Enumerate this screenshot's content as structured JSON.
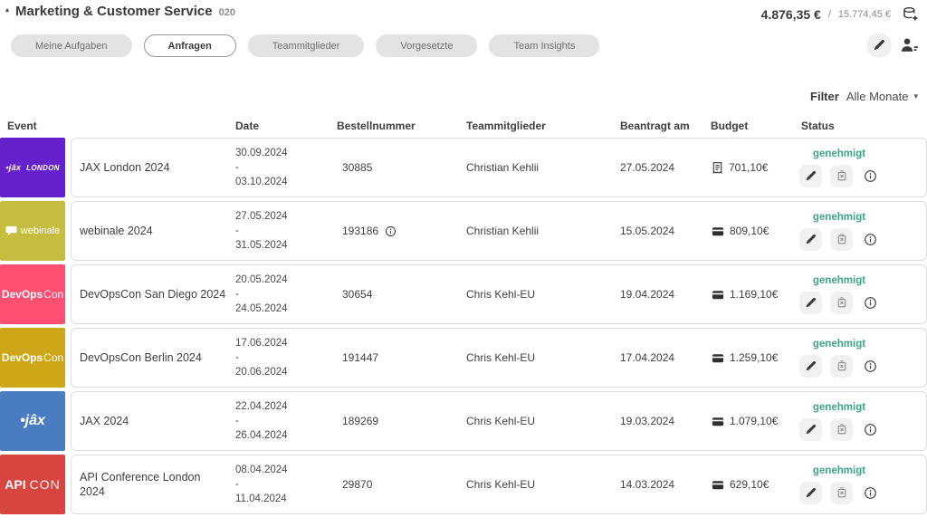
{
  "header": {
    "collapse_icon": "▴",
    "title": "Marketing & Customer Service",
    "code": "020",
    "budget_used": "4.876,35 €",
    "separator": "/",
    "budget_total": "15.774,45 €"
  },
  "tabs": [
    {
      "label": "Meine Aufgaben"
    },
    {
      "label": "Anfragen"
    },
    {
      "label": "Teammitglieder"
    },
    {
      "label": "Vorgesetzte"
    },
    {
      "label": "Team Insights"
    }
  ],
  "active_tab": "Anfragen",
  "filter": {
    "label": "Filter",
    "value": "Alle Monate",
    "caret": "▾"
  },
  "colors": {
    "status_approved": "#3fa38a",
    "logo_jax_london": "#6621cd",
    "logo_webinale": "#c5bd3f",
    "logo_devopscon_sandiego": "#fc4f72",
    "logo_devopscon_berlin": "#cda717",
    "logo_jax": "#4a7cc2",
    "logo_apicon": "#d84540"
  },
  "icons": {
    "top_right": "coins-plus-icon",
    "header_actions": [
      "pencil-icon",
      "person-add-icon"
    ],
    "row_actions": [
      "pencil-icon",
      "trash-icon",
      "info-icon"
    ],
    "budget_row_1": "receipt-icon",
    "budget_other_rows": "wallet-icon"
  },
  "table": {
    "columns": [
      "Event",
      "Date",
      "Bestellnummer",
      "Teammitglieder",
      "Beantragt am",
      "Budget",
      "Status"
    ],
    "rows": [
      {
        "logo": {
          "css": "background:#6621cd",
          "text1": "•jâx",
          "text2": "london"
        },
        "event": "JAX London 2024",
        "date_from": "30.09.2024",
        "date_sep": "-",
        "date_to": "03.10.2024",
        "bestellnummer": "30885",
        "teammitglied": "Christian Kehlii",
        "beantragt_am": "27.05.2024",
        "budget": "701,10€",
        "status": "genehmigt"
      },
      {
        "logo": {
          "css": "background:#c5bd3f",
          "text1": "",
          "text2": "webinale"
        },
        "event": "webinale 2024",
        "date_from": "27.05.2024",
        "date_sep": "-",
        "date_to": "31.05.2024",
        "bestellnummer": "193186",
        "teammitglied": "Christian Kehlii",
        "beantragt_am": "15.05.2024",
        "budget": "809,10€",
        "status": "genehmigt"
      },
      {
        "logo": {
          "css": "background:#fc4f72",
          "text1": "DevOps",
          "text2": "Con"
        },
        "event": "DevOpsCon San Diego 2024",
        "date_from": "20.05.2024",
        "date_sep": "-",
        "date_to": "24.05.2024",
        "bestellnummer": "30654",
        "teammitglied": "Chris Kehl-EU",
        "beantragt_am": "19.04.2024",
        "budget": "1.169,10€",
        "status": "genehmigt"
      },
      {
        "logo": {
          "css": "background:#cda717",
          "text1": "DevOps",
          "text2": "Con"
        },
        "event": "DevOpsCon Berlin 2024",
        "date_from": "17.06.2024",
        "date_sep": "-",
        "date_to": "20.06.2024",
        "bestellnummer": "191447",
        "teammitglied": "Chris Kehl-EU",
        "beantragt_am": "17.04.2024",
        "budget": "1.259,10€",
        "status": "genehmigt"
      },
      {
        "logo": {
          "css": "background:#4a7cc2",
          "text1": "•jâx",
          "text2": ""
        },
        "event": "JAX 2024",
        "date_from": "22.04.2024",
        "date_sep": "-",
        "date_to": "26.04.2024",
        "bestellnummer": "189269",
        "teammitglied": "Chris Kehl-EU",
        "beantragt_am": "19.03.2024",
        "budget": "1.079,10€",
        "status": "genehmigt"
      },
      {
        "logo": {
          "css": "background:#d84540",
          "text1": "API",
          "text2": "CON"
        },
        "event": "API Conference London 2024",
        "date_from": "08.04.2024",
        "date_sep": "-",
        "date_to": "11.04.2024",
        "bestellnummer": "29870",
        "teammitglied": "Chris Kehl-EU",
        "beantragt_am": "14.03.2024",
        "budget": "629,10€",
        "status": "genehmigt"
      }
    ]
  }
}
